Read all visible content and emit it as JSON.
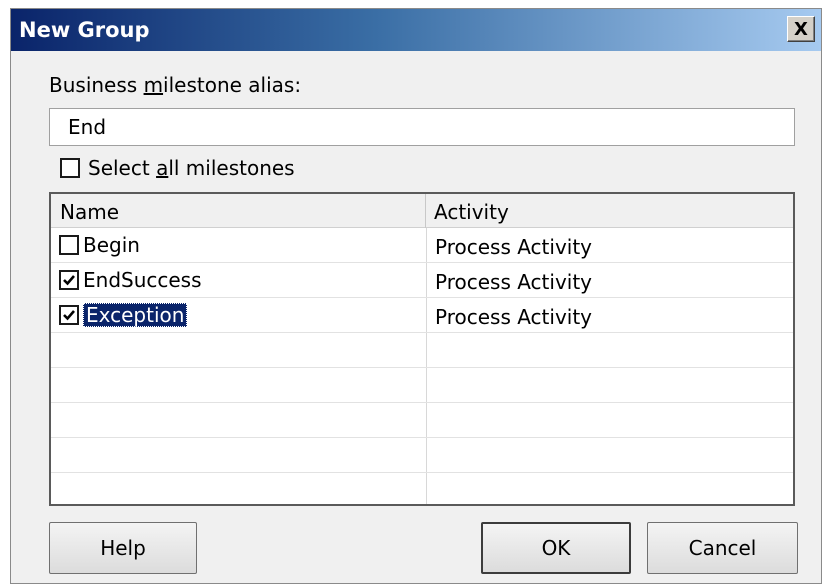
{
  "window": {
    "title": "New Group",
    "close_label": "X"
  },
  "alias": {
    "label_pre": "Business ",
    "label_accel": "m",
    "label_post": "ilestone alias:",
    "value": "End"
  },
  "select_all": {
    "label_pre": "Select ",
    "label_accel": "a",
    "label_post": "ll milestones",
    "checked": false
  },
  "list": {
    "columns": [
      "Name",
      "Activity"
    ],
    "rows": [
      {
        "name": "Begin",
        "activity": "Process Activity",
        "checked": false,
        "selected": false
      },
      {
        "name": "EndSuccess",
        "activity": "Process Activity",
        "checked": true,
        "selected": false
      },
      {
        "name": "Exception",
        "activity": "Process Activity",
        "checked": true,
        "selected": true
      }
    ]
  },
  "buttons": {
    "help": "Help",
    "ok": "OK",
    "cancel": "Cancel"
  },
  "colors": {
    "selection": "#0a246a",
    "title_start": "#0a246a",
    "title_end": "#a6caf0"
  }
}
